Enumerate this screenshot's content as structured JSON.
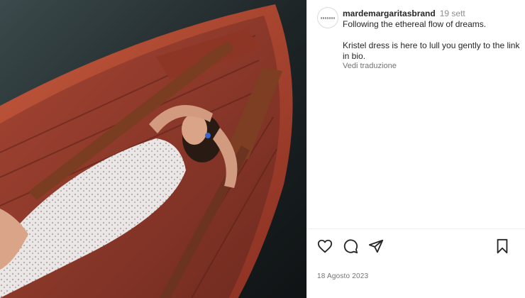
{
  "post": {
    "username": "mardemargaritasbrand",
    "time_ago": "19 sett",
    "caption_line1": "Following the ethereal flow of dreams.",
    "caption_line2": "Kristel dress is here to lull you gently to the link in bio.",
    "translate_link": "Vedi traduzione",
    "date": "18 Agosto 2023"
  },
  "icons": {
    "like": "heart-icon",
    "comment": "comment-icon",
    "share": "share-icon",
    "save": "bookmark-icon"
  },
  "colors": {
    "boat_wood": "#b14a35",
    "water": "#1f2527",
    "text_primary": "#262626",
    "text_secondary": "#8e8e8e"
  }
}
